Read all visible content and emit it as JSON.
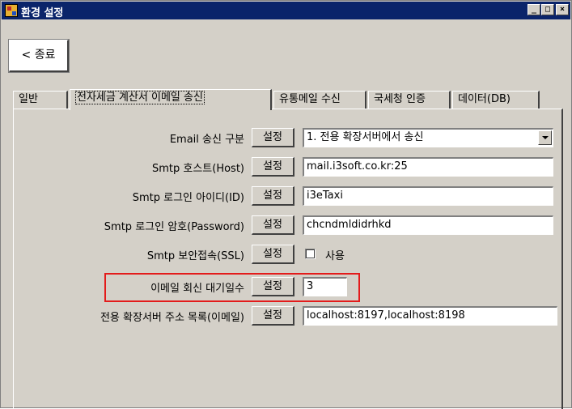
{
  "window": {
    "title": "환경 설정",
    "buttons": {
      "minimize": "_",
      "maximize": "□",
      "close": "×"
    }
  },
  "toolbar": {
    "back_label": "< 종료"
  },
  "tabs": [
    {
      "label": "일반"
    },
    {
      "label": "전자세금 계산서 이메일 송신"
    },
    {
      "label": "유통메일 수신"
    },
    {
      "label": "국세청 인증"
    },
    {
      "label": "데이터(DB)"
    }
  ],
  "set_label": "설정",
  "settings": [
    {
      "label": "Email 송신 구분",
      "value": "1. 전용 확장서버에서 송신"
    },
    {
      "label": "Smtp 호스트(Host)",
      "value": "mail.i3soft.co.kr:25"
    },
    {
      "label": "Smtp 로그인 아이디(ID)",
      "value": "i3eTaxi"
    },
    {
      "label": "Smtp 로그인 암호(Password)",
      "value": "chcndmldidrhkd"
    },
    {
      "label": "Smtp 보안접속(SSL)",
      "value": "사용",
      "checked": false
    },
    {
      "label": "이메일 회신 대기일수",
      "value": "3"
    },
    {
      "label": "전용 확장서버 주소 목록(이메일)",
      "value": "localhost:8197,localhost:8198"
    }
  ],
  "highlight_color": "#e31b1b"
}
